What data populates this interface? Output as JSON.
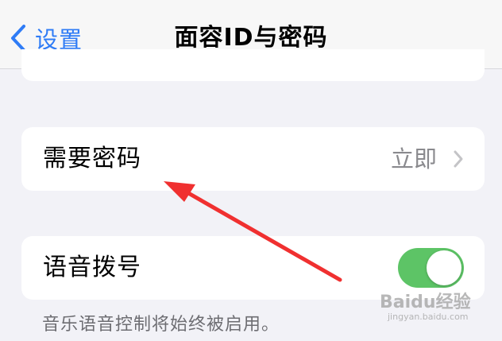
{
  "navbar": {
    "back_label": "设置",
    "title": "面容ID与密码"
  },
  "passcode_row": {
    "label": "需要密码",
    "value": "立即"
  },
  "voice_dial_row": {
    "label": "语音拨号",
    "toggle_on": true
  },
  "footer_note": "音乐语音控制将始终被启用。",
  "watermark": {
    "text": "Baidu经验",
    "sub": "jingyan.baidu.com"
  },
  "colors": {
    "accent": "#2f7cf6",
    "toggle_on": "#5dc466",
    "annotation_arrow": "#f03030"
  }
}
